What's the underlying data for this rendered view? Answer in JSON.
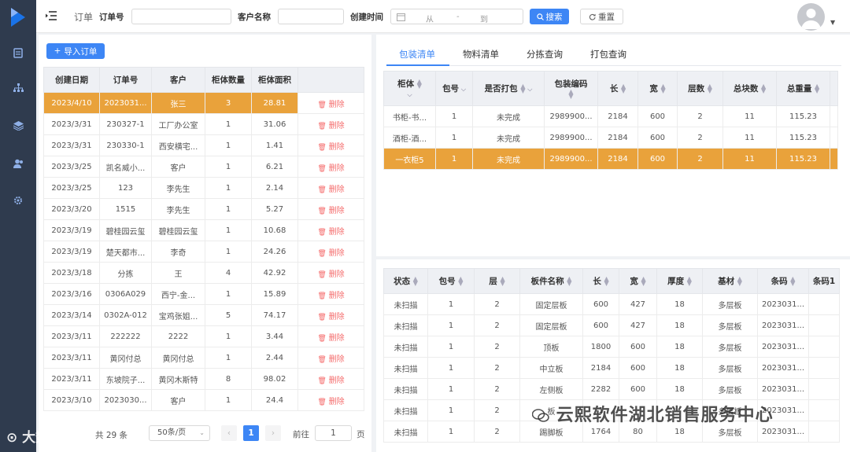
{
  "app": {
    "menu_title": "订单"
  },
  "search": {
    "order_no_label": "订单号",
    "customer_label": "客户名称",
    "created_label": "创建时间",
    "date_from": "从",
    "date_sep": "-",
    "date_to": "到",
    "search_label": "搜索",
    "reset_label": "重置"
  },
  "orders": {
    "import_label": "导入订单",
    "columns": [
      "创建日期",
      "订单号",
      "客户",
      "柜体数量",
      "柜体面积"
    ],
    "delete_label": "删除",
    "rows": [
      [
        "2023/4/10",
        "2023031...",
        "张三",
        "3",
        "28.81"
      ],
      [
        "2023/3/31",
        "230327-1",
        "工厂办公室",
        "1",
        "31.06"
      ],
      [
        "2023/3/31",
        "230330-1",
        "西安横宅...",
        "1",
        "1.41"
      ],
      [
        "2023/3/25",
        "凯名威小...",
        "客户",
        "1",
        "6.21"
      ],
      [
        "2023/3/25",
        "123",
        "李先生",
        "1",
        "2.14"
      ],
      [
        "2023/3/20",
        "1515",
        "李先生",
        "1",
        "5.27"
      ],
      [
        "2023/3/19",
        "碧桂园云玺",
        "碧桂园云玺",
        "1",
        "10.68"
      ],
      [
        "2023/3/19",
        "楚天都市...",
        "李奇",
        "1",
        "24.26"
      ],
      [
        "2023/3/18",
        "分拣",
        "王",
        "4",
        "42.92"
      ],
      [
        "2023/3/16",
        "0306A029",
        "西宁-金...",
        "1",
        "15.89"
      ],
      [
        "2023/3/14",
        "0302A-012",
        "宝鸡张姐...",
        "5",
        "74.17"
      ],
      [
        "2023/3/11",
        "222222",
        "2222",
        "1",
        "3.44"
      ],
      [
        "2023/3/11",
        "黄冈付总",
        "黄冈付总",
        "1",
        "2.44"
      ],
      [
        "2023/3/11",
        "东坡院子...",
        "黄冈木斯特",
        "8",
        "98.02"
      ],
      [
        "2023/3/10",
        "2023030...",
        "客户",
        "1",
        "24.4"
      ]
    ],
    "selected_index": 0
  },
  "pagination": {
    "total_text": "共 29 条",
    "page_size": "50条/页",
    "current_page": "1",
    "goto_label": "前往",
    "goto_value": "1",
    "page_unit": "页"
  },
  "tabs": [
    "包装清单",
    "物料清单",
    "分拣查询",
    "打包查询"
  ],
  "packing": {
    "columns": [
      "柜体",
      "包号",
      "是否打包",
      "包装编码",
      "长",
      "宽",
      "层数",
      "总块数",
      "总重量"
    ],
    "rows": [
      [
        "书柜-书...",
        "1",
        "未完成",
        "2989900...",
        "2184",
        "600",
        "2",
        "11",
        "115.23"
      ],
      [
        "酒柜-酒...",
        "1",
        "未完成",
        "2989900...",
        "2184",
        "600",
        "2",
        "11",
        "115.23"
      ],
      [
        "一衣柜5",
        "1",
        "未完成",
        "2989900...",
        "2184",
        "600",
        "2",
        "11",
        "115.23"
      ]
    ],
    "selected_index": 2
  },
  "boards": {
    "columns": [
      "状态",
      "包号",
      "层",
      "板件名称",
      "长",
      "宽",
      "厚度",
      "基材",
      "条码",
      "条码1"
    ],
    "rows": [
      [
        "未扫描",
        "1",
        "2",
        "固定层板",
        "600",
        "427",
        "18",
        "多层板",
        "2023031..."
      ],
      [
        "未扫描",
        "1",
        "2",
        "固定层板",
        "600",
        "427",
        "18",
        "多层板",
        "2023031..."
      ],
      [
        "未扫描",
        "1",
        "2",
        "顶板",
        "1800",
        "600",
        "18",
        "多层板",
        "2023031..."
      ],
      [
        "未扫描",
        "1",
        "2",
        "中立板",
        "2184",
        "600",
        "18",
        "多层板",
        "2023031..."
      ],
      [
        "未扫描",
        "1",
        "2",
        "左侧板",
        "2282",
        "600",
        "18",
        "多层板",
        "2023031..."
      ],
      [
        "未扫描",
        "1",
        "2",
        "板",
        "1",
        "",
        "",
        "多层板",
        "2023031..."
      ],
      [
        "未扫描",
        "1",
        "2",
        "踢脚板",
        "1764",
        "80",
        "18",
        "多层板",
        "2023031..."
      ]
    ]
  },
  "watermarks": {
    "wechat": "云熙软件湖北销售服务中心",
    "site": "大数跨境"
  },
  "colors": {
    "nav_bg": "#2f3b4e",
    "accent": "#3d86f5",
    "selected_row": "#e9a23b",
    "danger": "#f56c6c"
  }
}
